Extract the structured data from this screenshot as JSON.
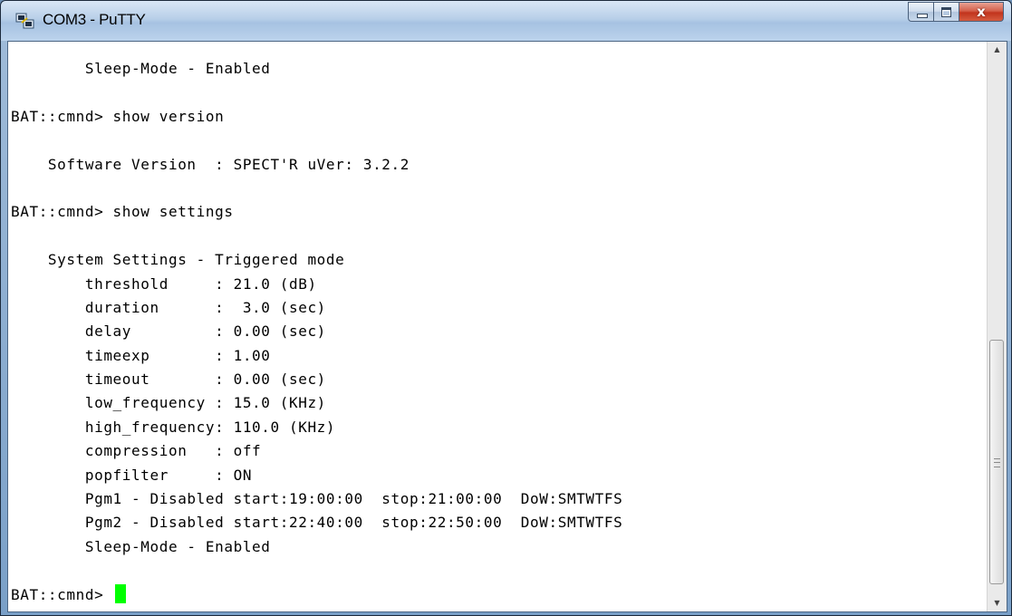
{
  "window": {
    "title": "COM3 - PuTTY",
    "close_glyph": "x"
  },
  "terminal": {
    "lines": [
      "        Sleep-Mode - Enabled",
      "",
      "BAT::cmnd> show version",
      "",
      "    Software Version  : SPECT'R uVer: 3.2.2",
      "",
      "BAT::cmnd> show settings",
      "",
      "    System Settings - Triggered mode",
      "        threshold     : 21.0 (dB)",
      "        duration      :  3.0 (sec)",
      "        delay         : 0.00 (sec)",
      "        timeexp       : 1.00",
      "        timeout       : 0.00 (sec)",
      "        low_frequency : 15.0 (KHz)",
      "        high_frequency: 110.0 (KHz)",
      "        compression   : off",
      "        popfilter     : ON",
      "        Pgm1 - Disabled start:19:00:00  stop:21:00:00  DoW:SMTWTFS",
      "        Pgm2 - Disabled start:22:40:00  stop:22:50:00  DoW:SMTWTFS",
      "        Sleep-Mode - Enabled",
      "",
      "BAT::cmnd> "
    ],
    "cursor_color": "#00ff00"
  },
  "scrollbar": {
    "up_arrow": "▲",
    "down_arrow": "▼"
  }
}
